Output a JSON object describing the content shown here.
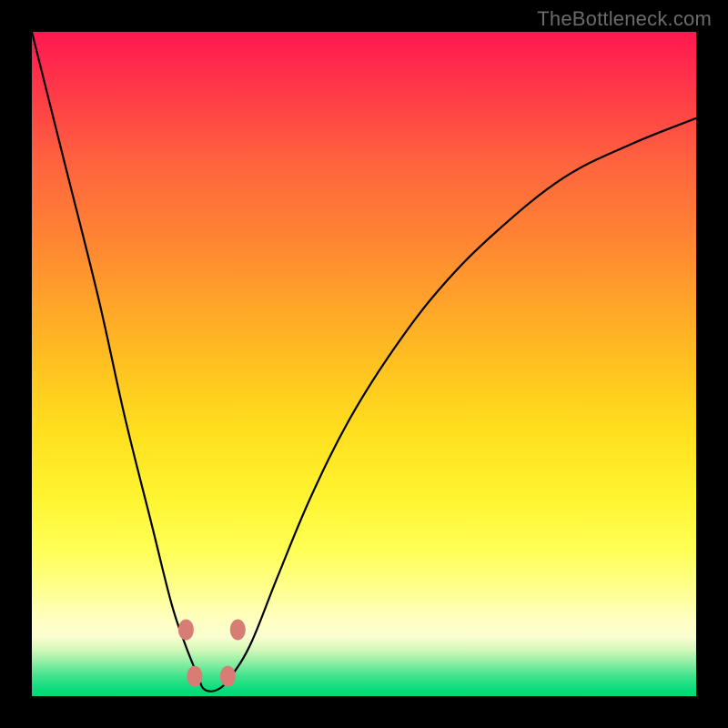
{
  "watermark": "TheBottleneck.com",
  "colors": {
    "background": "#000000",
    "curve": "#000000",
    "markers": "#d87c76",
    "gradient_top": "#ff1850",
    "gradient_bottom": "#00db75"
  },
  "chart_data": {
    "type": "line",
    "title": "",
    "xlabel": "",
    "ylabel": "",
    "xlim": [
      0,
      1
    ],
    "ylim": [
      0,
      100
    ],
    "series": [
      {
        "name": "bottleneck-curve",
        "x": [
          0.0,
          0.05,
          0.1,
          0.14,
          0.18,
          0.21,
          0.23,
          0.25,
          0.26,
          0.28,
          0.3,
          0.33,
          0.37,
          0.42,
          0.48,
          0.55,
          0.62,
          0.7,
          0.8,
          0.9,
          1.0
        ],
        "y": [
          100,
          80,
          60,
          42,
          26,
          14,
          8,
          3,
          1,
          1,
          3,
          8,
          18,
          30,
          42,
          53,
          62,
          70,
          78,
          83,
          87
        ]
      }
    ],
    "annotations": [
      {
        "name": "min-shoulder-left-upper",
        "x": 0.232,
        "y": 10.0
      },
      {
        "name": "min-shoulder-left-lower",
        "x": 0.245,
        "y": 3.0
      },
      {
        "name": "min-shoulder-right-lower",
        "x": 0.295,
        "y": 3.0
      },
      {
        "name": "min-shoulder-right-upper",
        "x": 0.31,
        "y": 10.0
      }
    ]
  }
}
